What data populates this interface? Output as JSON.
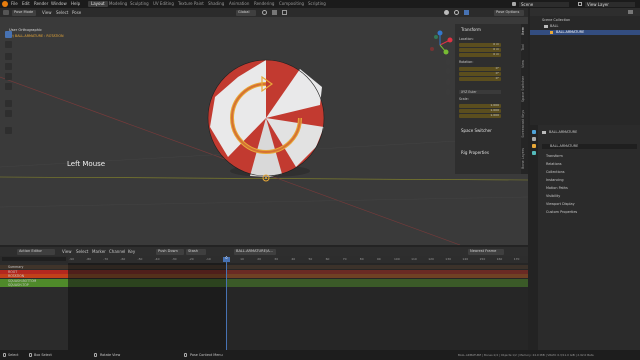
{
  "menus": [
    "File",
    "Edit",
    "Render",
    "Window",
    "Help"
  ],
  "workspaces": [
    {
      "label": "Layout",
      "active": true
    },
    {
      "label": "Modeling"
    },
    {
      "label": "Sculpting"
    },
    {
      "label": "UV Editing"
    },
    {
      "label": "Texture Paint"
    },
    {
      "label": "Shading"
    },
    {
      "label": "Animation"
    },
    {
      "label": "Rendering"
    },
    {
      "label": "Compositing"
    },
    {
      "label": "Scripting"
    }
  ],
  "topright": {
    "scene_label": "Scene",
    "viewlayer_label": "View Layer"
  },
  "viewport_header": {
    "mode": "Pose Mode",
    "menus": [
      "View",
      "Select",
      "Pose"
    ],
    "orientation": "Global",
    "pose_options": "Pose Options"
  },
  "viewport": {
    "view_name": "User Orthographic",
    "object_info": "(0) BALL.ARMATURE : ROTATION",
    "overlay_text": "Left Mouse"
  },
  "npanel": {
    "transform_header": "Transform",
    "location_label": "Location:",
    "location": [
      "0 m",
      "0 m",
      "0 m"
    ],
    "rotation_label": "Rotation:",
    "rotation": [
      "0°",
      "0°",
      "0°"
    ],
    "rotation_mode": "XYZ Euler",
    "scale_label": "Scale:",
    "scale": [
      "1.000",
      "1.000",
      "1.000"
    ],
    "space_switcher": "Space Switcher",
    "rig_properties": "Rig Properties",
    "tabs": [
      "Item",
      "Tool",
      "View",
      "Space Switcher",
      "Screencast Keys",
      "Bone Layers"
    ]
  },
  "outliner": {
    "items": [
      "Scene Collection",
      "BALL",
      "BALL.ARMATURE"
    ]
  },
  "properties": {
    "bone_name": "BALL.ARMATURE",
    "bone_field": "BALL.ARMATURE",
    "sections": [
      "Transform",
      "Relations",
      "Collections",
      "Instancing",
      "Motion Paths",
      "Visibility",
      "Viewport Display",
      "Custom Properties"
    ]
  },
  "timeline": {
    "editor": "Action Editor",
    "menus": [
      "View",
      "Select",
      "Marker",
      "Channel",
      "Key"
    ],
    "push_down": "Push Down",
    "stash": "Stash",
    "action": "BALL.ARMATURE/A...",
    "snap": "Nearest Frame",
    "ticks": [
      "-90",
      "-80",
      "-70",
      "-60",
      "-50",
      "-40",
      "-30",
      "-20",
      "-10",
      "0",
      "10",
      "20",
      "30",
      "40",
      "50",
      "60",
      "70",
      "80",
      "90",
      "100",
      "110",
      "120",
      "130",
      "140",
      "150",
      "160",
      "170"
    ],
    "current_frame": "0",
    "channels": [
      {
        "name": "Summary",
        "color": "#40342a"
      },
      {
        "name": "ROOT",
        "color": "#b3281f"
      },
      {
        "name": "ROTATION",
        "color": "#c0401a"
      },
      {
        "name": "SQUASH-BOTTOM",
        "color": "#4f8a2a"
      },
      {
        "name": "SQUASH-TOP",
        "color": "#4f8a2a"
      }
    ]
  },
  "statusbar": {
    "select": "Select",
    "box_select": "Box Select",
    "rotate_view": "Rotate View",
    "context_menu": "Pose Context Menu",
    "info": "BALL.ARMATURE | Bones:1/4 | Objects:1/2 | Memory: 24.9 MiB | VRAM: 0.3/11.0 GiB | 2.92.0 Beta"
  },
  "colors": {
    "accent": "#4772b3",
    "selected": "#e8a838",
    "ball_red": "#c23a30"
  }
}
